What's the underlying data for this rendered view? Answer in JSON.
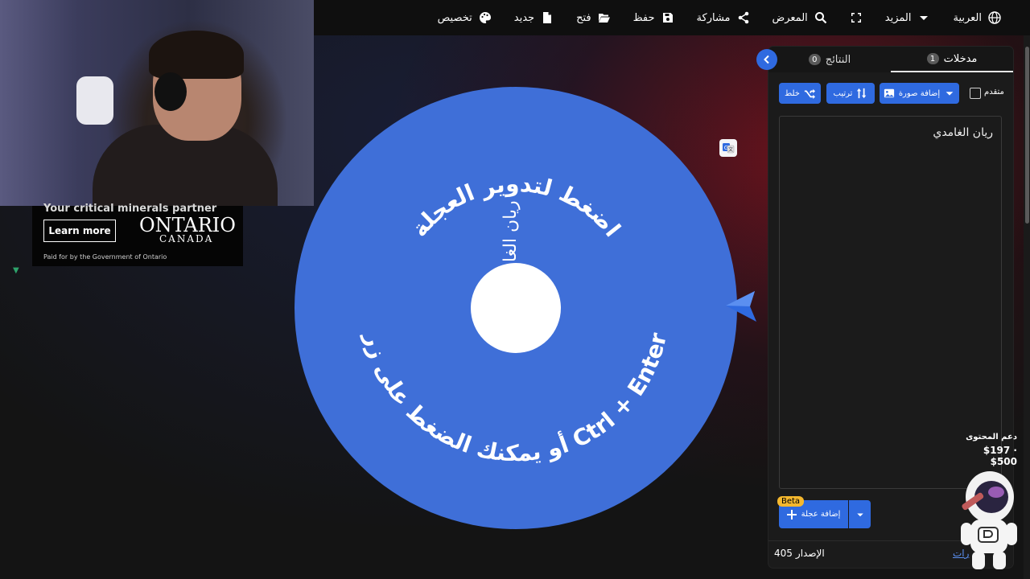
{
  "toolbar": {
    "items": [
      {
        "label": "العربية",
        "icon": "globe-icon"
      },
      {
        "label": "المزيد",
        "icon": "caret-down-icon"
      },
      {
        "label": "",
        "icon": "fullscreen-icon"
      },
      {
        "label": "المعرض",
        "icon": "search-icon"
      },
      {
        "label": "مشاركة",
        "icon": "share-icon"
      },
      {
        "label": "حفظ",
        "icon": "save-icon"
      },
      {
        "label": "فتح",
        "icon": "folder-open-icon"
      },
      {
        "label": "جديد",
        "icon": "file-icon"
      },
      {
        "label": "تخصيص",
        "icon": "palette-icon"
      }
    ]
  },
  "ad": {
    "headline": "Your critical minerals partner",
    "button": "Learn more",
    "logo": "ONTARIO",
    "logo_sub": "CANADA",
    "paid": "Paid for by the Government of Ontario"
  },
  "wheel": {
    "color": "#3f6fd8",
    "entry_text": "ريان الغامدي",
    "prompt_top": "اضغط لتدوير العجلة",
    "prompt_bottom": "أو يمكنك الضغط على زر Ctrl + Enter"
  },
  "panel": {
    "tabs": [
      {
        "label": "النتائج",
        "count": "0"
      },
      {
        "label": "مدخلات",
        "count": "1",
        "active": true
      }
    ],
    "buttons": {
      "shuffle": "خلط",
      "sort": "ترتيب",
      "add_image": "إضافة صورة",
      "advanced": "متقدم"
    },
    "entries": "ريان الغامدي",
    "add_wheel": "إضافة عجلة",
    "beta": "Beta",
    "version_label": "الإصدار",
    "version_number": "405",
    "changes_link": "رات"
  },
  "support": {
    "title": "دعم المحتوى",
    "amount": "$197 · $500"
  },
  "colors": {
    "accent": "#2f6ae0",
    "wheel": "#3f6fd8",
    "beta": "#f5b82e"
  }
}
